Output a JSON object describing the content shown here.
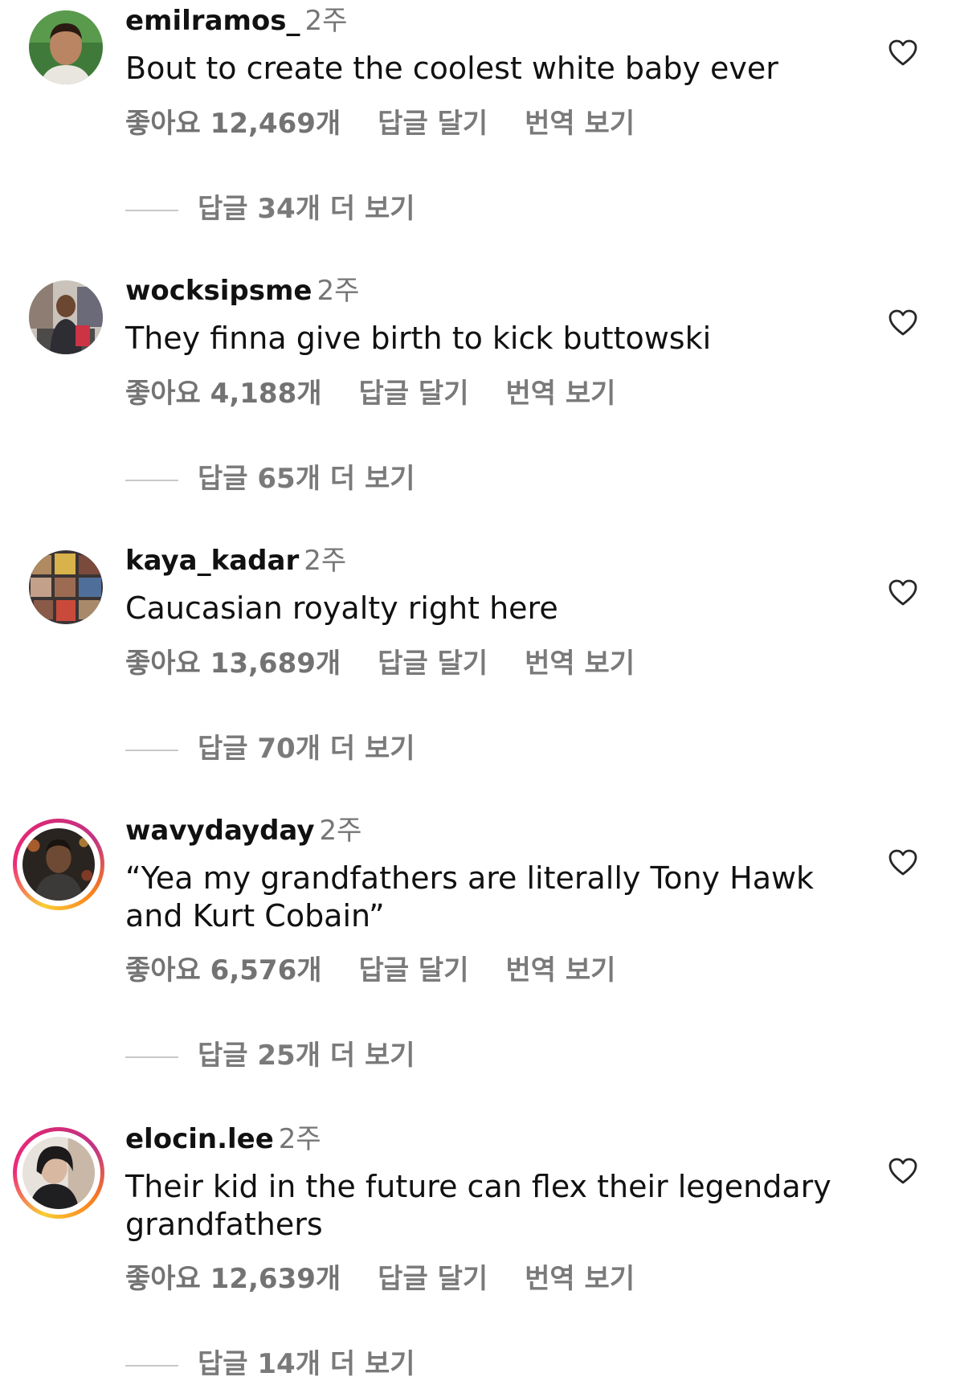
{
  "comments": [
    {
      "username": "emilramos_",
      "time": "2주",
      "text": "Bout to create the coolest white baby ever",
      "likes": "좋아요 12,469개",
      "reply": "답글 달기",
      "translate": "번역 보기",
      "more_replies": "답글 34개 더 보기",
      "avatar_icon": "profile-photo",
      "has_story": false
    },
    {
      "username": "wocksipsme",
      "time": "2주",
      "text": "They finna give birth to kick buttowski",
      "likes": "좋아요 4,188개",
      "reply": "답글 달기",
      "translate": "번역 보기",
      "more_replies": "답글 65개 더 보기",
      "avatar_icon": "profile-photo",
      "has_story": false
    },
    {
      "username": "kaya_kadar",
      "time": "2주",
      "text": "Caucasian royalty right here",
      "likes": "좋아요 13,689개",
      "reply": "답글 달기",
      "translate": "번역 보기",
      "more_replies": "답글 70개 더 보기",
      "avatar_icon": "profile-photo",
      "has_story": false
    },
    {
      "username": "wavydayday",
      "time": "2주",
      "text": "“Yea my grandfathers are literally Tony Hawk and Kurt Cobain”",
      "likes": "좋아요 6,576개",
      "reply": "답글 달기",
      "translate": "번역 보기",
      "more_replies": "답글 25개 더 보기",
      "avatar_icon": "profile-photo",
      "has_story": true
    },
    {
      "username": "elocin.lee",
      "time": "2주",
      "text": "Their kid in the future can flex their legendary grandfathers",
      "likes": "좋아요 12,639개",
      "reply": "답글 달기",
      "translate": "번역 보기",
      "more_replies": "답글 14개 더 보기",
      "avatar_icon": "profile-photo",
      "has_story": true
    }
  ],
  "icons": {
    "like": "heart-outline-icon"
  },
  "colors": {
    "text": "#111111",
    "muted": "#7a7a7a",
    "heart_stroke": "#262626",
    "story_ring": "#ee2a7b"
  }
}
